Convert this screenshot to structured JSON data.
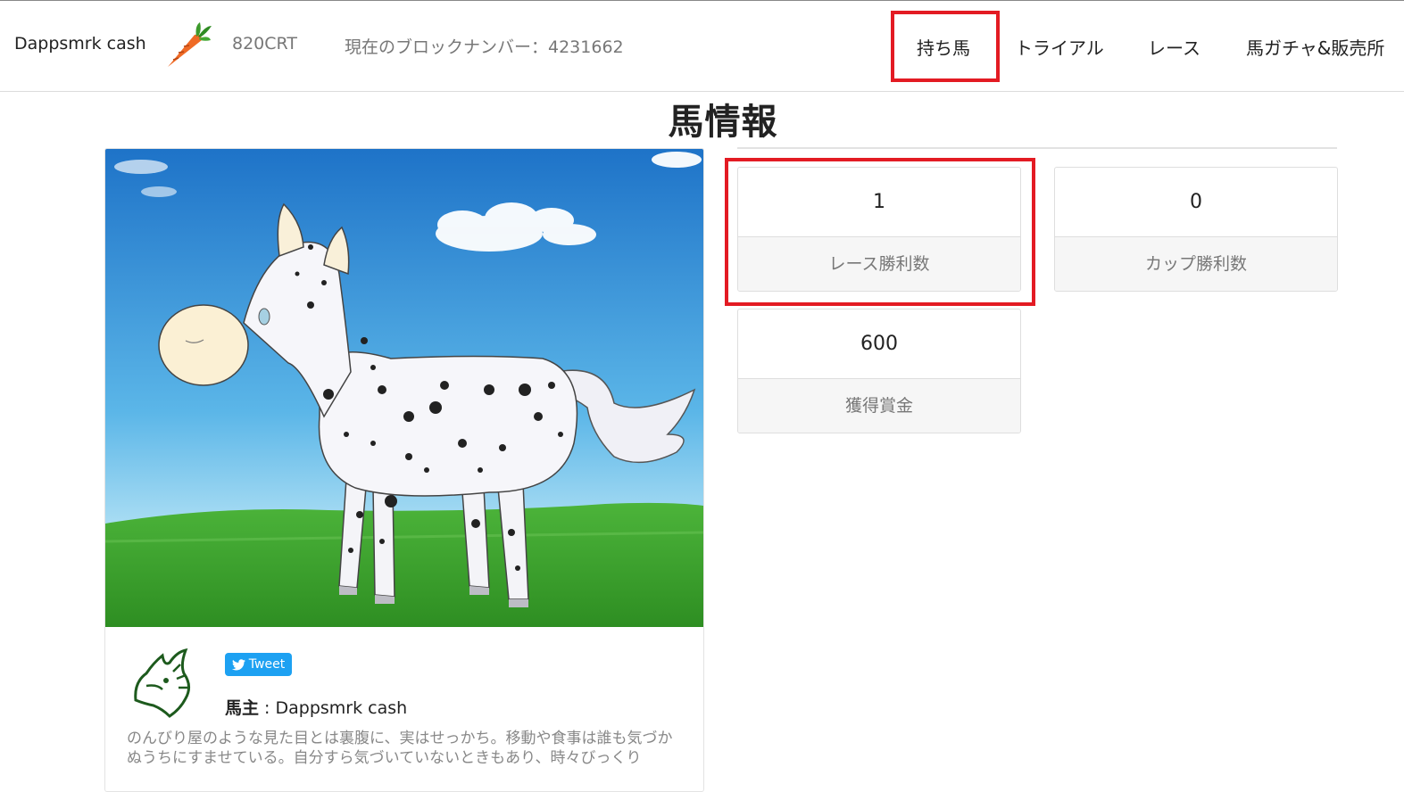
{
  "header": {
    "brand": "Dappsmrk cash",
    "balance": "820CRT",
    "block_label": "現在のブロックナンバー：4231662"
  },
  "nav": {
    "owned": "持ち馬",
    "trial": "トライアル",
    "race": "レース",
    "gacha": "馬ガチャ&販売所"
  },
  "page": {
    "title": "馬情報"
  },
  "horse": {
    "tweet_label": "Tweet",
    "owner_prefix": "馬主",
    "owner_name": " : Dappsmrk cash",
    "description": "のんびり屋のような見た目とは裏腹に、実はせっかち。移動や食事は誰も気づかぬうちにすませている。自分すら気づいていないときもあり、時々びっくり"
  },
  "stats": [
    {
      "value": "1",
      "label": "レース勝利数"
    },
    {
      "value": "0",
      "label": "カップ勝利数"
    },
    {
      "value": "600",
      "label": "獲得賞金"
    }
  ],
  "colors": {
    "highlight": "#e31b23",
    "tweet": "#1da1f2",
    "sky_top": "#1e73c8",
    "grass": "#3aa32a"
  },
  "icons": [
    "carrot-icon",
    "horse-avatar-icon",
    "twitter-bird-icon"
  ]
}
